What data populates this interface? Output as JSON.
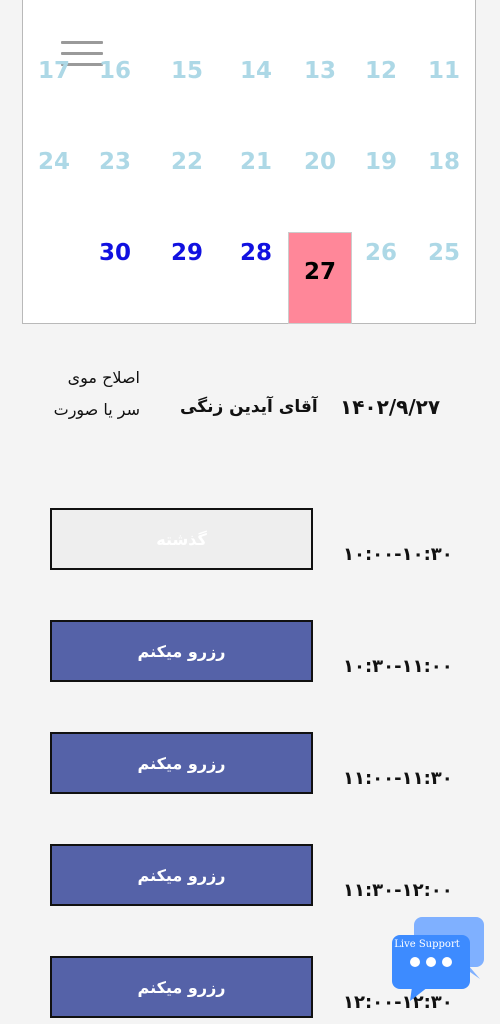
{
  "calendar": {
    "rows": [
      [
        {
          "day": "11",
          "state": "inactive"
        },
        {
          "day": "12",
          "state": "inactive"
        },
        {
          "day": "13",
          "state": "inactive"
        },
        {
          "day": "14",
          "state": "inactive"
        },
        {
          "day": "15",
          "state": "inactive"
        },
        {
          "day": "16",
          "state": "inactive"
        },
        {
          "day": "17",
          "state": "inactive"
        }
      ],
      [
        {
          "day": "18",
          "state": "inactive"
        },
        {
          "day": "19",
          "state": "inactive"
        },
        {
          "day": "20",
          "state": "inactive"
        },
        {
          "day": "21",
          "state": "inactive"
        },
        {
          "day": "22",
          "state": "inactive"
        },
        {
          "day": "23",
          "state": "inactive"
        },
        {
          "day": "24",
          "state": "inactive"
        }
      ],
      [
        {
          "day": "25",
          "state": "inactive"
        },
        {
          "day": "26",
          "state": "inactive"
        },
        {
          "day": "27",
          "state": "selected"
        },
        {
          "day": "28",
          "state": "active"
        },
        {
          "day": "29",
          "state": "active"
        },
        {
          "day": "30",
          "state": "active"
        }
      ]
    ],
    "selected_color": "#ff8799",
    "active_color": "#1111e0",
    "inactive_color": "#add8e6"
  },
  "menu_icon": "hamburger-icon",
  "appointment": {
    "date": "۱۴۰۲/۹/۲۷",
    "barber": "آقای آیدین زنگی",
    "service": "اصلاح موی سر یا صورت"
  },
  "slots": [
    {
      "time": "۱۰:۰۰-۱۰:۳۰",
      "button": "گذشته",
      "status": "passed"
    },
    {
      "time": "۱۰:۳۰-۱۱:۰۰",
      "button": "رزرو میکنم",
      "status": "available"
    },
    {
      "time": "۱۱:۰۰-۱۱:۳۰",
      "button": "رزرو میکنم",
      "status": "available"
    },
    {
      "time": "۱۱:۳۰-۱۲:۰۰",
      "button": "رزرو میکنم",
      "status": "available"
    },
    {
      "time": "۱۲:۰۰-۱۲:۳۰",
      "button": "رزرو میکنم",
      "status": "available"
    }
  ],
  "support": {
    "label": "Live Support",
    "icon": "chat-bubble-icon"
  },
  "colors": {
    "reserve_button": "#5562a8",
    "passed_button": "#eeeeee",
    "support_front": "#3d8bff",
    "support_back": "#7fb0ff"
  }
}
